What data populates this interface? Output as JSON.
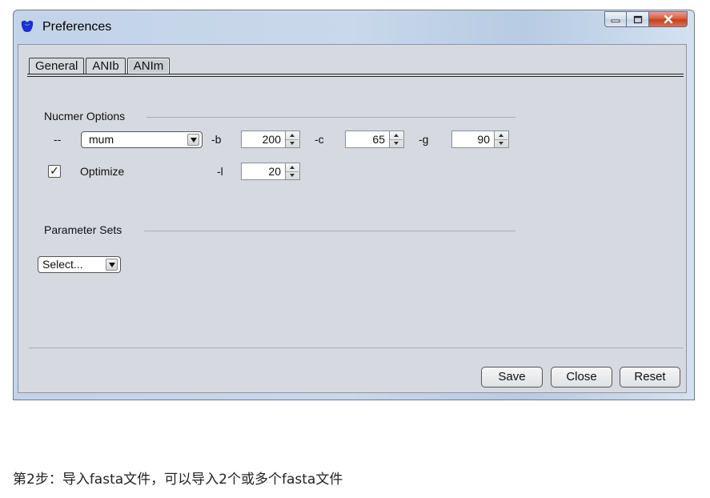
{
  "window": {
    "title": "Preferences"
  },
  "tabs": [
    {
      "label": "General"
    },
    {
      "label": "ANIb"
    },
    {
      "label": "ANIm",
      "active": true
    }
  ],
  "nucmer": {
    "group_label": "Nucmer Options",
    "mode_label": "--",
    "mode_value": "mum",
    "b_label": "-b",
    "b_value": "200",
    "c_label": "-c",
    "c_value": "65",
    "g_label": "-g",
    "g_value": "90",
    "optimize_label": "Optimize",
    "optimize_checked": true,
    "checkmark": "✓",
    "l_label": "-l",
    "l_value": "20"
  },
  "parameter_sets": {
    "group_label": "Parameter Sets",
    "select_value": "Select..."
  },
  "buttons": {
    "save": "Save",
    "close": "Close",
    "reset": "Reset"
  },
  "caption": "第2步：导入fasta文件，可以导入2个或多个fasta文件",
  "icons": {
    "app": "app-logo-icon",
    "minimize": "minimize-icon",
    "maximize": "maximize-icon",
    "close": "close-icon",
    "dropdown": "chevron-down-icon",
    "spin_up": "spin-up-icon",
    "spin_down": "spin-down-icon"
  },
  "colors": {
    "app_icon": "#1a2fd4",
    "close_button": "#c8462a",
    "client_bg": "#d6d9df"
  }
}
